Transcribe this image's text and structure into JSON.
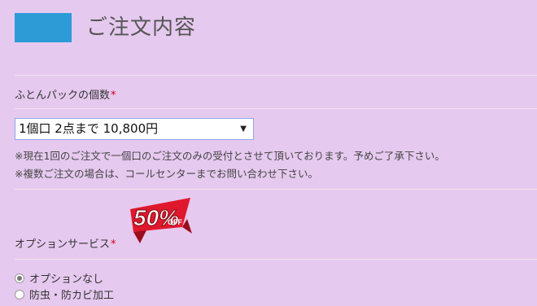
{
  "header": {
    "title": "ご注文内容",
    "block_color": "#2d9bd6"
  },
  "pack_field": {
    "label": "ふとんパックの個数",
    "required_mark": "*",
    "selected": "1個口 2点まで 10,800円",
    "arrow": "▼",
    "notes": [
      "※現在1回のご注文で一個口のご注文のみの受付とさせて頂いております。予めご了承下さい。",
      "※複数ご注文の場合は、コールセンターまでお問い合わせ下さい。"
    ]
  },
  "badge": {
    "percent": "50%",
    "off": "OFF",
    "color": "#e0182d"
  },
  "option_field": {
    "label": "オプションサービス",
    "required_mark": "*",
    "options": [
      {
        "label": "オプションなし",
        "checked": true
      },
      {
        "label": "防虫・防カビ加工",
        "checked": false
      }
    ]
  }
}
